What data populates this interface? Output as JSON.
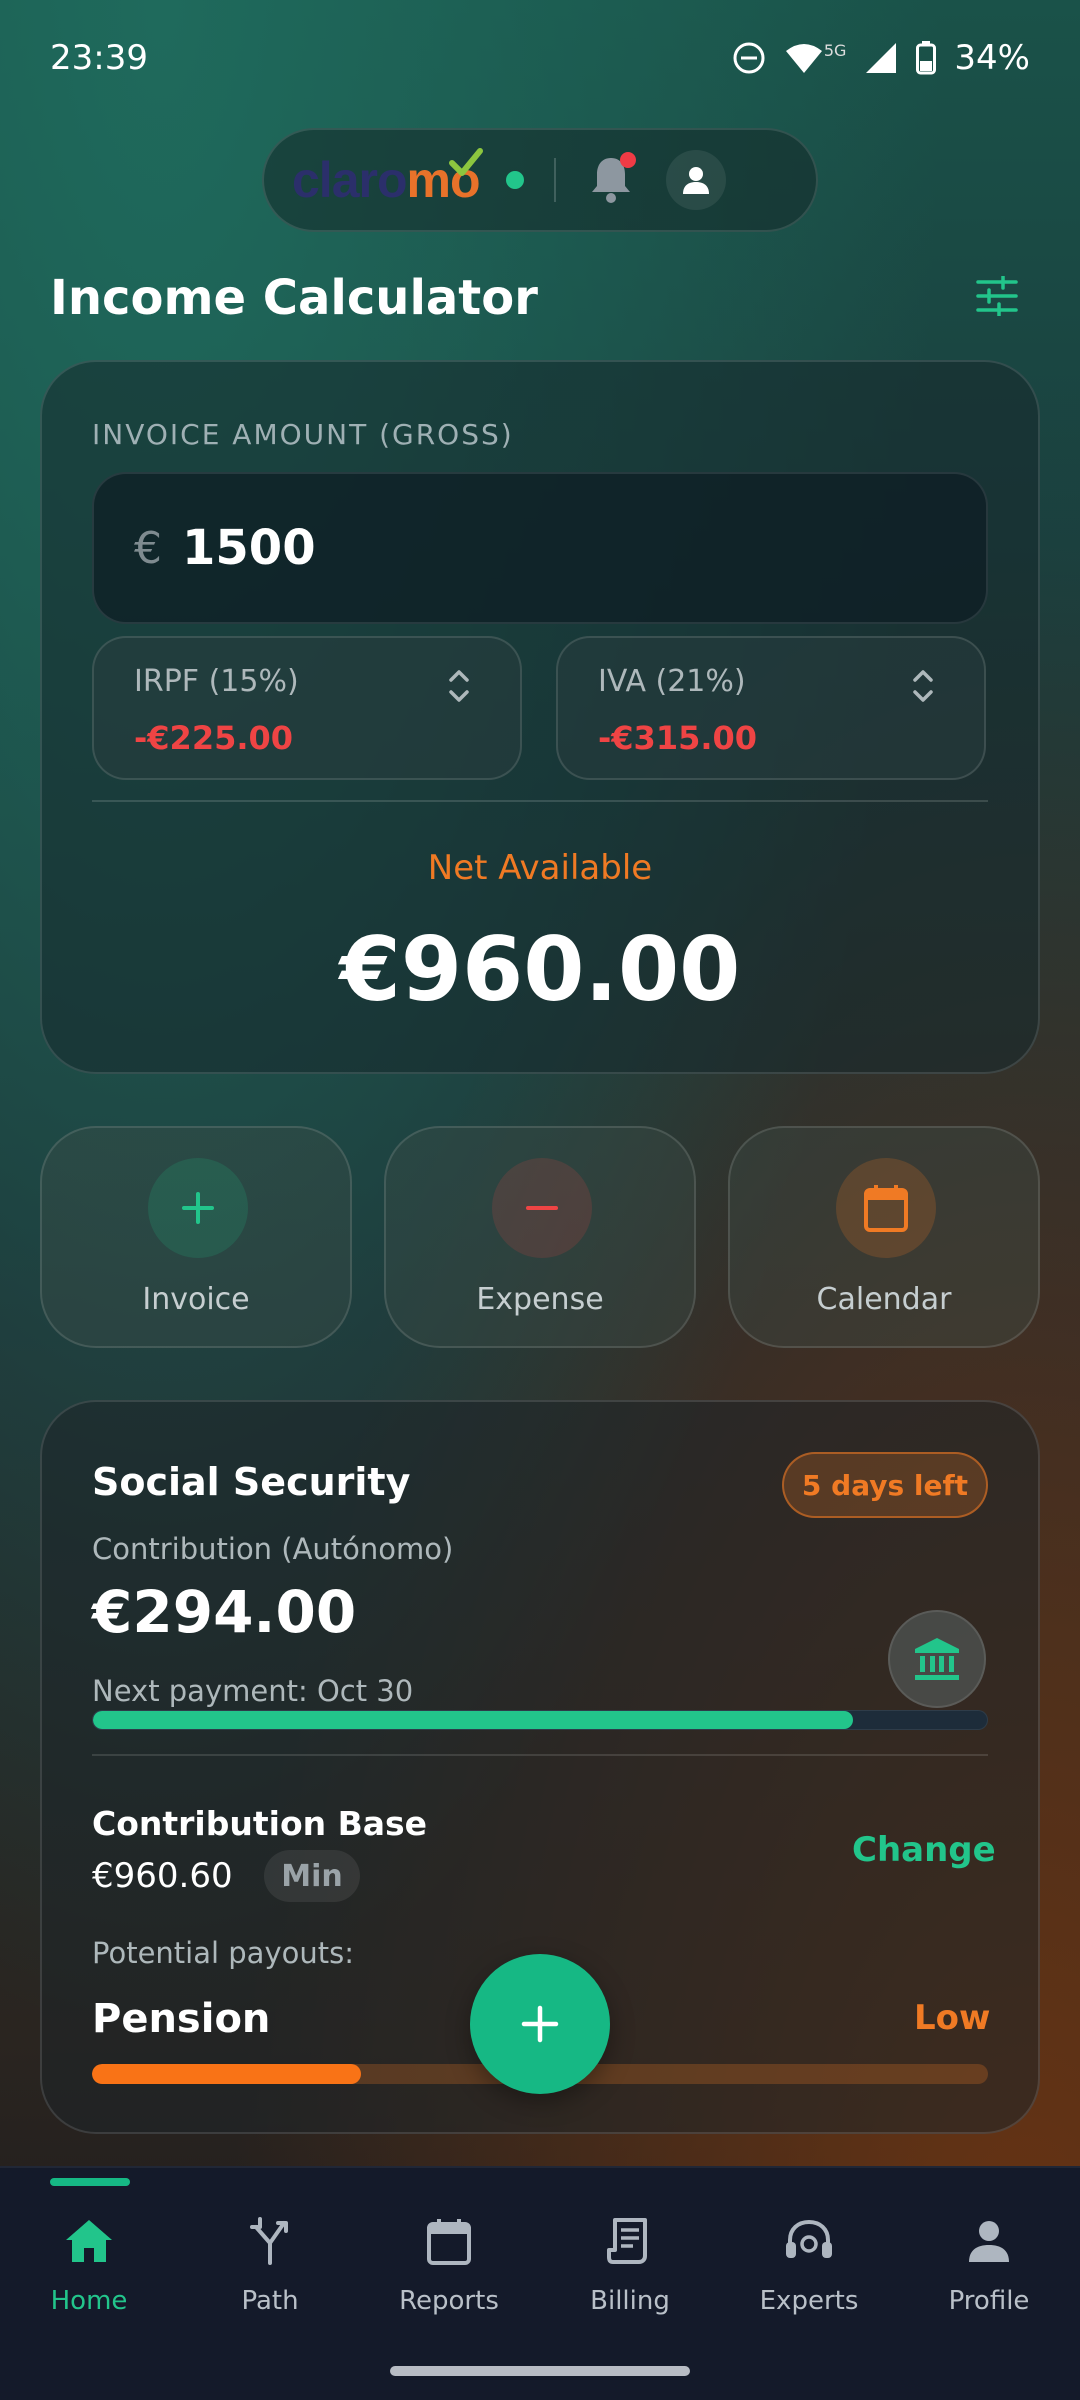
{
  "status_bar": {
    "time": "23:39",
    "battery": "34%",
    "network": "5G"
  },
  "header": {
    "logo_part1": "claro",
    "logo_part2": "mo",
    "page_title": "Income Calculator"
  },
  "calculator": {
    "field_label": "INVOICE AMOUNT (GROSS)",
    "currency_symbol": "€",
    "amount_value": "1500",
    "irpf_label": "IRPF (15%)",
    "irpf_value": "-€225.00",
    "iva_label": "IVA (21%)",
    "iva_value": "-€315.00",
    "net_label": "Net Available",
    "net_value": "€960.00"
  },
  "quick_actions": [
    {
      "label": "Invoice",
      "icon": "plus-icon"
    },
    {
      "label": "Expense",
      "icon": "minus-icon"
    },
    {
      "label": "Calendar",
      "icon": "calendar-icon"
    }
  ],
  "social_security": {
    "title": "Social Security",
    "days_left": "5 days left",
    "subtitle": "Contribution (Autónomo)",
    "amount": "€294.00",
    "next_payment": "Next payment: Oct 30",
    "progress_fraction": 0.85,
    "contribution_base_label": "Contribution Base",
    "contribution_base_value": "€960.60",
    "min_badge": "Min",
    "change_label": "Change",
    "payouts_label": "Potential payouts:",
    "pension_label": "Pension",
    "pension_level": "Low",
    "pension_fraction": 0.3
  },
  "bottom_nav": [
    {
      "label": "Home",
      "icon": "home-icon",
      "active": true
    },
    {
      "label": "Path",
      "icon": "path-icon",
      "active": false
    },
    {
      "label": "Reports",
      "icon": "calendar-icon",
      "active": false
    },
    {
      "label": "Billing",
      "icon": "receipt-icon",
      "active": false
    },
    {
      "label": "Experts",
      "icon": "headset-icon",
      "active": false
    },
    {
      "label": "Profile",
      "icon": "person-icon",
      "active": false
    }
  ],
  "colors": {
    "accent_green": "#22c58b",
    "accent_orange": "#f07a24",
    "negative_red": "#ef4444"
  }
}
